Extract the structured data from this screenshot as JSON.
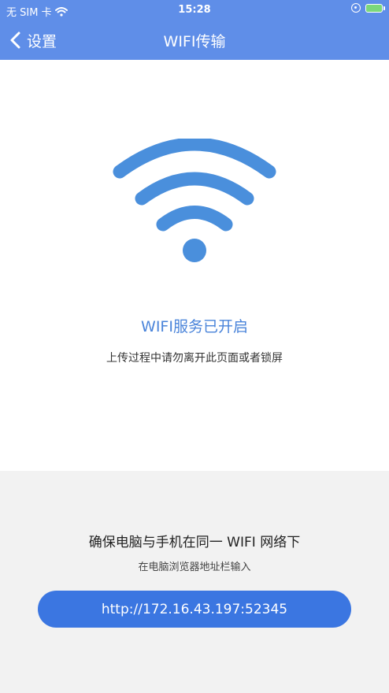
{
  "status_bar": {
    "carrier": "无 SIM 卡",
    "time": "15:28",
    "icons": [
      "wifi-icon",
      "orientation-lock-icon",
      "battery-charging-icon"
    ]
  },
  "nav": {
    "back_label": "设置",
    "title": "WIFI传输"
  },
  "main": {
    "icon": "wifi-icon",
    "status": "WIFI服务已开启",
    "warning": "上传过程中请勿离开此页面或者锁屏"
  },
  "bottom": {
    "same_network": "确保电脑与手机在同一 WIFI 网络下",
    "instruction": "在电脑浏览器地址栏输入",
    "url": "http://172.16.43.197:52345"
  },
  "colors": {
    "header": "#5f8ee8",
    "accent": "#3b76e1",
    "wifi_icon": "#4a8fdc",
    "status_text": "#4a84da",
    "bottom_bg": "#f2f2f2"
  }
}
